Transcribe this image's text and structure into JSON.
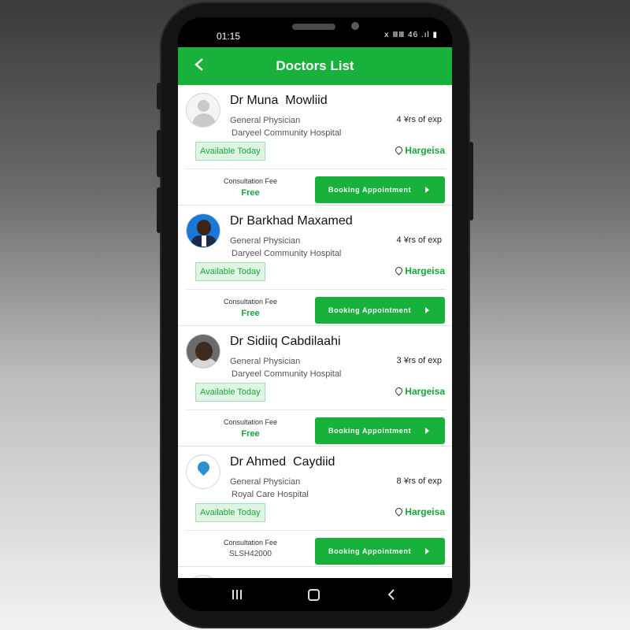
{
  "status_bar": {
    "time": "01:15",
    "icons": "ⅹ ⅢⅢ 46 .ıl ▮"
  },
  "app_bar": {
    "title": "Doctors List",
    "back_icon": "chevron-left-icon"
  },
  "colors": {
    "primary": "#17b13b",
    "available_bg": "#dff5e3"
  },
  "doctors": [
    {
      "name": "Dr Muna  Mowliid",
      "specialty": "General Physician",
      "hospital": "Daryeel Community Hospital",
      "experience": "4  ¥rs of exp",
      "availability": "Available Today",
      "location": "Hargeisa",
      "fee_label": "Consultation Fee",
      "fee": "Free",
      "book_label": "Booking Appointment"
    },
    {
      "name": "Dr Barkhad Maxamed",
      "specialty": "General Physician",
      "hospital": "Daryeel Community Hospital",
      "experience": "4  ¥rs of exp",
      "availability": "Available Today",
      "location": "Hargeisa",
      "fee_label": "Consultation Fee",
      "fee": "Free",
      "book_label": "Booking Appointment"
    },
    {
      "name": "Dr Sidiiq Cabdilaahi",
      "specialty": "General Physician",
      "hospital": "Daryeel Community Hospital",
      "experience": "3  ¥rs of exp",
      "availability": "Available Today",
      "location": "Hargeisa",
      "fee_label": "Consultation Fee",
      "fee": "Free",
      "book_label": "Booking Appointment"
    },
    {
      "name": "Dr Ahmed  Caydiid",
      "specialty": "General Physician",
      "hospital": "Royal Care Hospital",
      "experience": "8  ¥rs of exp",
      "availability": "Available Today",
      "location": "Hargeisa",
      "fee_label": "Consultation Fee",
      "fee": "SLSH42000",
      "book_label": "Booking Appointment"
    }
  ]
}
